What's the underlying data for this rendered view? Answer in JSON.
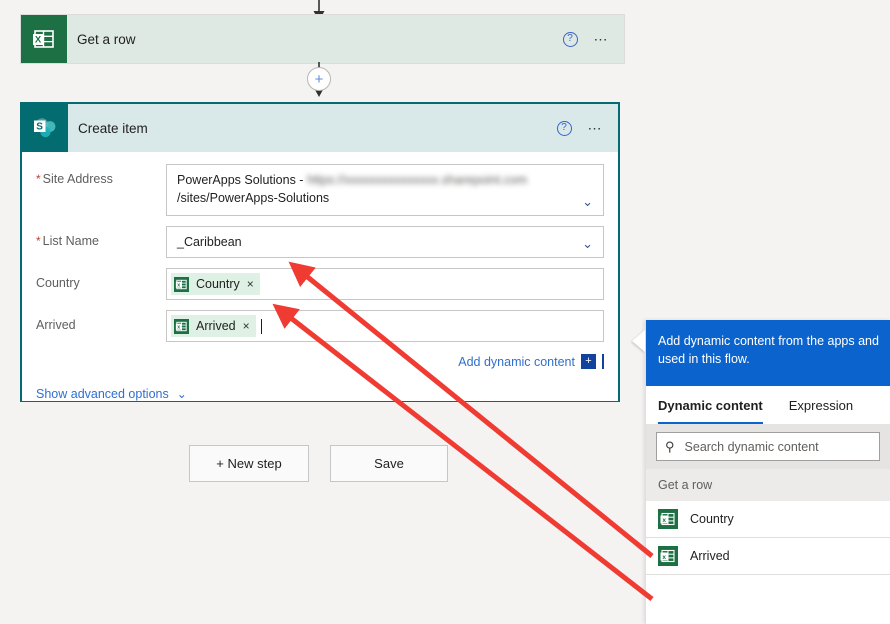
{
  "flow": {
    "steps": [
      {
        "title": "Get a row",
        "connector": "excel-icon",
        "help_icon": "help-circle-icon",
        "menu_icon": "ellipsis-icon"
      },
      {
        "title": "Create item",
        "connector": "sharepoint-icon",
        "help_icon": "help-circle-icon",
        "menu_icon": "ellipsis-icon"
      }
    ],
    "insert_button_label": "+"
  },
  "form": {
    "fields": [
      {
        "label": "Site Address",
        "required": true,
        "value_prefix": "PowerApps Solutions - ",
        "value_blurred": "https://xxxxxxxxxxxxxxx.sharepoint.com",
        "value_suffix": "/sites/PowerApps-Solutions",
        "type": "dropdown"
      },
      {
        "label": "List Name",
        "required": true,
        "value": "_Caribbean",
        "type": "dropdown"
      },
      {
        "label": "Country",
        "required": false,
        "type": "token",
        "token": {
          "text": "Country",
          "icon": "excel-icon",
          "remove_label": "×"
        }
      },
      {
        "label": "Arrived",
        "required": false,
        "type": "token",
        "token": {
          "text": "Arrived",
          "icon": "excel-icon",
          "remove_label": "×"
        },
        "has_caret": true
      }
    ],
    "add_dynamic_content": {
      "label": "Add dynamic content",
      "badge": "+"
    },
    "show_advanced": {
      "label": "Show advanced options",
      "chevron": "chevron-down-icon"
    }
  },
  "actions": {
    "new_step": "+ New step",
    "save": "Save"
  },
  "dynamic_panel": {
    "tooltip": "Add dynamic content from the apps and used in this flow.",
    "tabs": [
      {
        "label": "Dynamic content",
        "active": true
      },
      {
        "label": "Expression",
        "active": false
      }
    ],
    "search": {
      "placeholder": "Search dynamic content",
      "value": "",
      "icon": "search-icon"
    },
    "groups": [
      {
        "title": "Get a row",
        "items": [
          {
            "label": "Country",
            "icon": "excel-icon"
          },
          {
            "label": "Arrived",
            "icon": "excel-icon"
          }
        ]
      }
    ]
  },
  "annotations": {
    "arrow_color": "#ef3b32",
    "arrows": [
      {
        "from": "dc-item-country",
        "to": "token-country"
      },
      {
        "from": "dc-item-arrived",
        "to": "token-arrived"
      }
    ]
  },
  "colors": {
    "excel_green": "#1d7044",
    "sharepoint_teal": "#036c70",
    "excel_card_header": "#dde9e2",
    "sharepoint_card_header": "#d9e8e8",
    "link_blue": "#2f6fd0",
    "tooltip_blue": "#0b63ce",
    "token_bg": "#dff0e4",
    "required_red": "#c3412f"
  }
}
